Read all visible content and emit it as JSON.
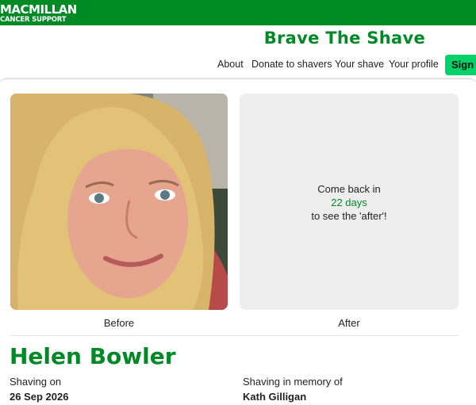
{
  "header": {
    "logo_line1": "MACMILLAN",
    "logo_line2": "CANCER SUPPORT",
    "brand_title": "Brave The Shave",
    "nav": [
      "About",
      "Donate to shavers",
      "Your shave",
      "Your profile"
    ],
    "sign_in_label": "Sign in"
  },
  "gallery": {
    "after_message_top": "Come back in",
    "after_days": "22 days",
    "after_message_bottom": "to see the 'after'!",
    "before_caption": "Before",
    "after_caption": "After"
  },
  "profile": {
    "name": "Helen Bowler",
    "shaving_on_label": "Shaving on",
    "shaving_on_value": "26 Sep 2026",
    "memory_label": "Shaving in memory of",
    "memory_value": "Kath Gilligan"
  },
  "colors": {
    "brand_green": "#008a26",
    "button_green": "#00d26a",
    "panel_grey": "#eeeeee"
  }
}
